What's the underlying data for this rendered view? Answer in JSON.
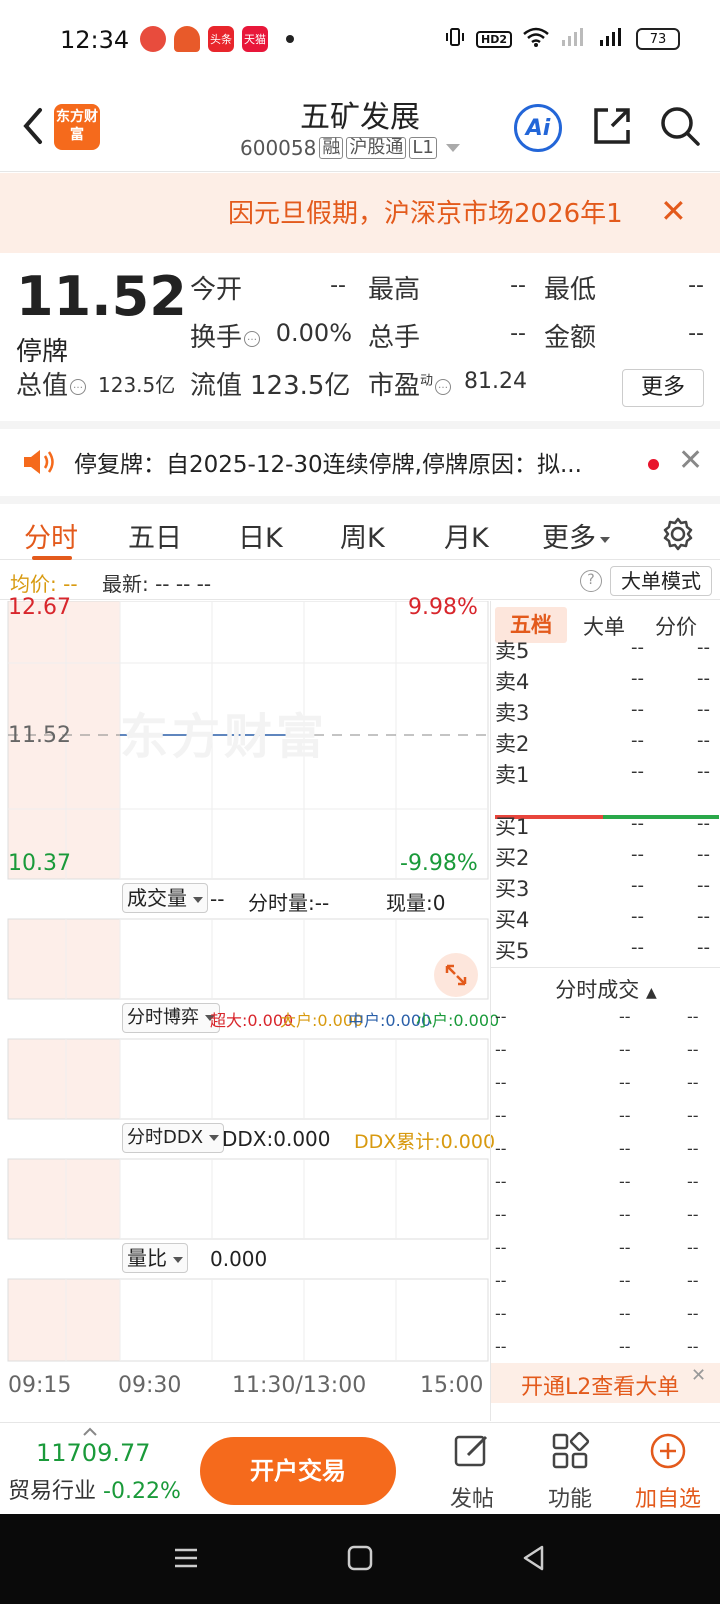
{
  "status_bar": {
    "time": "12:34",
    "apps": [
      {
        "label": "",
        "color": "#e84c3d"
      },
      {
        "label": "",
        "color": "#e85a2a"
      },
      {
        "label": "头条",
        "color": "#e8262c"
      },
      {
        "label": "天猫",
        "color": "#e8173a"
      }
    ],
    "battery": "73"
  },
  "header": {
    "logo": "东方财富",
    "title": "五矿发展",
    "code": "600058",
    "tag_margin": "融",
    "tag_connect": "沪股通",
    "tag_level": "L1",
    "ai_label": "Ai"
  },
  "notice": {
    "text": "因元旦假期，沪深京市场2026年1",
    "close": "✕"
  },
  "quote": {
    "price": "11.52",
    "status": "停牌",
    "open_label": "今开",
    "open_value": "--",
    "high_label": "最高",
    "high_value": "--",
    "low_label": "最低",
    "low_value": "--",
    "turnover_label": "换手",
    "turnover_value": "0.00%",
    "volume_label": "总手",
    "volume_value": "--",
    "amount_label": "金额",
    "amount_value": "--",
    "mcap_label": "总值",
    "mcap_value": "123.5亿",
    "float_label": "流值",
    "float_value": "123.5亿",
    "pe_label": "市盈",
    "pe_sup": "动",
    "pe_value": "81.24",
    "more": "更多"
  },
  "halt_notice": {
    "text": "停复牌：自2025-12-30连续停牌,停牌原因：拟...",
    "close": "✕"
  },
  "tabs": [
    "分时",
    "五日",
    "日K",
    "周K",
    "月K",
    "更多"
  ],
  "avg_row": {
    "avg_label": "均价:",
    "avg_value": "--",
    "latest": "最新: --  --  --",
    "help": "?",
    "big_mode": "大单模式"
  },
  "chart": {
    "price_high": "12.67",
    "price_mid": "11.52",
    "price_low": "10.37",
    "pct_high": "9.98%",
    "pct_low": "-9.98%",
    "watermark": "东方财富",
    "volume_select": "成交量",
    "volume_dash": "--",
    "tick_volume": "分时量:--",
    "current_volume": "现量:0",
    "game_select": "分时博弈",
    "game_super": "超大:0.000",
    "game_big": "大户:0.000",
    "game_mid": "中户:0.000",
    "game_small": "小户:0.000",
    "ddx_select": "分时DDX",
    "ddx": "DDX:0.000",
    "ddx_total": "DDX累计:0.000",
    "ratio_select": "量比",
    "ratio": "0.000",
    "times": [
      "09:15",
      "09:30",
      "11:30/13:00",
      "15:00"
    ]
  },
  "panel": {
    "tabs": [
      "五档",
      "大单",
      "分价"
    ],
    "sells": [
      {
        "name": "卖5",
        "price": "--",
        "vol": "--"
      },
      {
        "name": "卖4",
        "price": "--",
        "vol": "--"
      },
      {
        "name": "卖3",
        "price": "--",
        "vol": "--"
      },
      {
        "name": "卖2",
        "price": "--",
        "vol": "--"
      },
      {
        "name": "卖1",
        "price": "--",
        "vol": "--"
      }
    ],
    "buys": [
      {
        "name": "买1",
        "price": "--",
        "vol": "--"
      },
      {
        "name": "买2",
        "price": "--",
        "vol": "--"
      },
      {
        "name": "买3",
        "price": "--",
        "vol": "--"
      },
      {
        "name": "买4",
        "price": "--",
        "vol": "--"
      },
      {
        "name": "买5",
        "price": "--",
        "vol": "--"
      }
    ],
    "trades_title": "分时成交",
    "trade_rows": [
      [
        "--",
        "--",
        "--"
      ],
      [
        "--",
        "--",
        "--"
      ],
      [
        "--",
        "--",
        "--"
      ],
      [
        "--",
        "--",
        "--"
      ],
      [
        "--",
        "--",
        "--"
      ],
      [
        "--",
        "--",
        "--"
      ],
      [
        "--",
        "--",
        "--"
      ],
      [
        "--",
        "--",
        "--"
      ],
      [
        "--",
        "--",
        "--"
      ],
      [
        "--",
        "--",
        "--"
      ],
      [
        "--",
        "--",
        "--"
      ]
    ],
    "l2_banner": "开通L2查看大单",
    "l2_close": "✕"
  },
  "bottom_bar": {
    "index_value": "11709.77",
    "industry": "贸易行业",
    "industry_change": "-0.22%",
    "open_account": "开户交易",
    "post": "发帖",
    "functions": "功能",
    "add_watch": "加自选"
  },
  "colors": {
    "accent": "#e35a1c",
    "up": "#d8262c",
    "down": "#1a9a3a",
    "price_line": "#2a5fa8"
  }
}
